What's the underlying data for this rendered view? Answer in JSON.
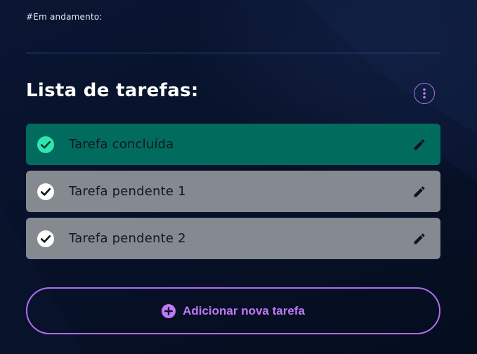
{
  "status": {
    "label": "#Em andamento:"
  },
  "task_list": {
    "title": "Lista de tarefas:",
    "more_icon": "more-vertical-icon",
    "tasks": [
      {
        "label": "Tarefa concluída",
        "status": "done",
        "check_icon": "check-circle-icon",
        "edit_icon": "pencil-icon"
      },
      {
        "label": "Tarefa pendente 1",
        "status": "pending",
        "check_icon": "check-circle-icon",
        "edit_icon": "pencil-icon"
      },
      {
        "label": "Tarefa pendente 2",
        "status": "pending",
        "check_icon": "check-circle-icon",
        "edit_icon": "pencil-icon"
      }
    ]
  },
  "add_button": {
    "label": "Adicionar nova tarefa",
    "icon": "plus-circle-icon"
  },
  "colors": {
    "background": "#060f24",
    "accent_purple": "#b26cf0",
    "done_task": "#016c5d",
    "pending_task": "#858990",
    "done_check": "#2ee6b0"
  }
}
